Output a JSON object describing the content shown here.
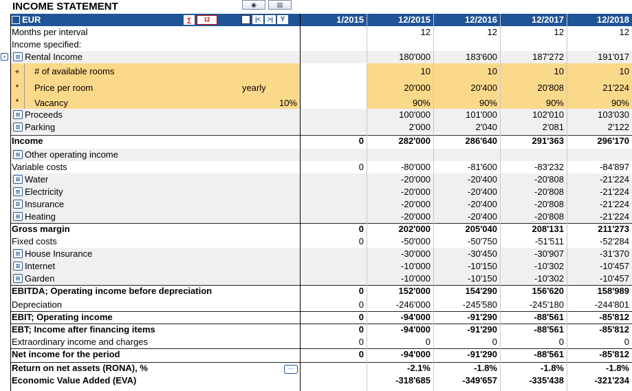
{
  "title": "INCOME STATEMENT",
  "currency": "EUR",
  "periods": [
    "1/2015",
    "12/2015",
    "12/2016",
    "12/2017",
    "12/2018"
  ],
  "rows": [
    {
      "label": "Months per interval",
      "values": [
        "",
        "12",
        "12",
        "12",
        "12"
      ]
    },
    {
      "label": "Income specified:",
      "values": [
        "",
        "",
        "",
        "",
        ""
      ]
    },
    {
      "label": "Rental Income",
      "values": [
        "",
        "180'000",
        "183'600",
        "187'272",
        "191'017"
      ]
    },
    {
      "sign": "+",
      "label": "# of available rooms",
      "values": [
        "",
        "10",
        "10",
        "10",
        "10"
      ]
    },
    {
      "sign": "*",
      "label": "Price per room",
      "extra": "yearly",
      "values": [
        "",
        "20'000",
        "20'400",
        "20'808",
        "21'224"
      ]
    },
    {
      "sign": "*",
      "label": "Vacancy",
      "extra": "10%",
      "values": [
        "",
        "90%",
        "90%",
        "90%",
        "90%"
      ]
    },
    {
      "label": "Proceeds",
      "values": [
        "",
        "100'000",
        "101'000",
        "102'010",
        "103'030"
      ]
    },
    {
      "label": "Parking",
      "values": [
        "",
        "2'000",
        "2'040",
        "2'081",
        "2'122"
      ]
    },
    {
      "label": "Income",
      "values": [
        "0",
        "282'000",
        "286'640",
        "291'363",
        "296'170"
      ]
    },
    {
      "label": "Other operating income",
      "values": [
        "",
        "",
        "",
        "",
        ""
      ]
    },
    {
      "label": "Variable costs",
      "values": [
        "0",
        "-80'000",
        "-81'600",
        "-83'232",
        "-84'897"
      ]
    },
    {
      "label": "Water",
      "values": [
        "",
        "-20'000",
        "-20'400",
        "-20'808",
        "-21'224"
      ]
    },
    {
      "label": "Electricity",
      "values": [
        "",
        "-20'000",
        "-20'400",
        "-20'808",
        "-21'224"
      ]
    },
    {
      "label": "Insurance",
      "values": [
        "",
        "-20'000",
        "-20'400",
        "-20'808",
        "-21'224"
      ]
    },
    {
      "label": "Heating",
      "values": [
        "",
        "-20'000",
        "-20'400",
        "-20'808",
        "-21'224"
      ]
    },
    {
      "label": "Gross margin",
      "values": [
        "0",
        "202'000",
        "205'040",
        "208'131",
        "211'273"
      ]
    },
    {
      "label": "Fixed costs",
      "values": [
        "0",
        "-50'000",
        "-50'750",
        "-51'511",
        "-52'284"
      ]
    },
    {
      "label": "House Insurance",
      "values": [
        "",
        "-30'000",
        "-30'450",
        "-30'907",
        "-31'370"
      ]
    },
    {
      "label": "Internet",
      "values": [
        "",
        "-10'000",
        "-10'150",
        "-10'302",
        "-10'457"
      ]
    },
    {
      "label": "Garden",
      "values": [
        "",
        "-10'000",
        "-10'150",
        "-10'302",
        "-10'457"
      ]
    },
    {
      "label": "EBITDA; Operating income before depreciation",
      "values": [
        "0",
        "152'000",
        "154'290",
        "156'620",
        "158'989"
      ]
    },
    {
      "label": "Depreciation",
      "values": [
        "0",
        "-246'000",
        "-245'580",
        "-245'180",
        "-244'801"
      ]
    },
    {
      "label": "EBIT; Operating income",
      "values": [
        "0",
        "-94'000",
        "-91'290",
        "-88'561",
        "-85'812"
      ]
    },
    {
      "label": "EBT; Income after financing items",
      "values": [
        "0",
        "-94'000",
        "-91'290",
        "-88'561",
        "-85'812"
      ]
    },
    {
      "label": "Extraordinary income and charges",
      "values": [
        "0",
        "0",
        "0",
        "0",
        "0"
      ]
    },
    {
      "label": "Net income for the period",
      "values": [
        "0",
        "-94'000",
        "-91'290",
        "-88'561",
        "-85'812"
      ]
    },
    {
      "label": "Return on net assets (RONA), %",
      "values": [
        "",
        "-2.1%",
        "-1.8%",
        "-1.8%",
        "-1.8%"
      ]
    },
    {
      "label": "Economic Value Added (EVA)",
      "values": [
        "",
        "-318'685",
        "-349'657",
        "-335'438",
        "-321'234"
      ]
    }
  ],
  "colors": {
    "header_blue": "#1f5496",
    "input_yellow": "#fbd98a",
    "shade_gray": "#f0f0f0"
  },
  "icons": [
    "camera-icon",
    "table-icon",
    "calculator-icon",
    "format-icon",
    "first-icon",
    "prev-icon",
    "next-icon",
    "filter-icon",
    "expand-icon",
    "more-icon"
  ]
}
